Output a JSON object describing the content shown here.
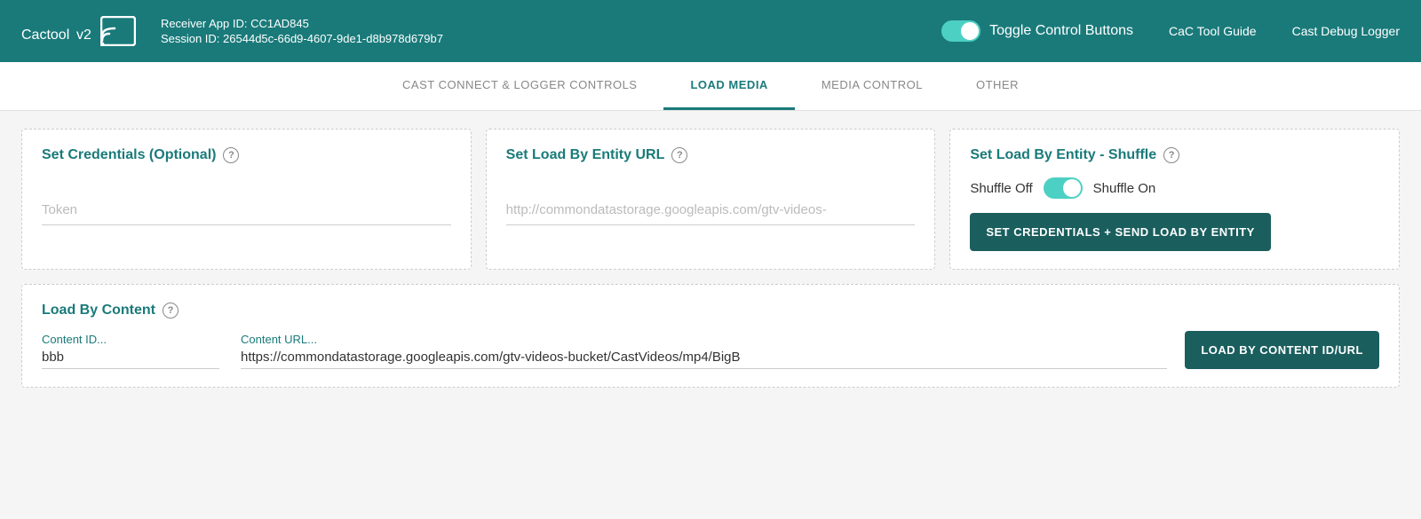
{
  "header": {
    "logo_text": "Cactool",
    "logo_version": "v2",
    "receiver_app_id_label": "Receiver App ID:",
    "receiver_app_id_value": "CC1AD845",
    "session_id_label": "Session ID:",
    "session_id_value": "26544d5c-66d9-4607-9de1-d8b978d679b7",
    "toggle_label": "Toggle Control Buttons",
    "nav_links": [
      "CaC Tool Guide",
      "Cast Debug Logger"
    ]
  },
  "tabs": [
    {
      "label": "CAST CONNECT & LOGGER CONTROLS",
      "active": false
    },
    {
      "label": "LOAD MEDIA",
      "active": true
    },
    {
      "label": "MEDIA CONTROL",
      "active": false
    },
    {
      "label": "OTHER",
      "active": false
    }
  ],
  "load_media": {
    "credentials_card": {
      "title": "Set Credentials (Optional)",
      "token_placeholder": "Token"
    },
    "entity_url_card": {
      "title": "Set Load By Entity URL",
      "url_placeholder": "http://commondatastorage.googleapis.com/gtv-videos-"
    },
    "entity_shuffle_card": {
      "title": "Set Load By Entity - Shuffle",
      "shuffle_off_label": "Shuffle Off",
      "shuffle_on_label": "Shuffle On",
      "button_label": "SET CREDENTIALS + SEND LOAD BY ENTITY"
    },
    "load_content_card": {
      "title": "Load By Content",
      "content_id_label": "Content ID...",
      "content_id_value": "bbb",
      "content_url_label": "Content URL...",
      "content_url_value": "https://commondatastorage.googleapis.com/gtv-videos-bucket/CastVideos/mp4/BigB",
      "button_label": "LOAD BY CONTENT ID/URL"
    }
  }
}
